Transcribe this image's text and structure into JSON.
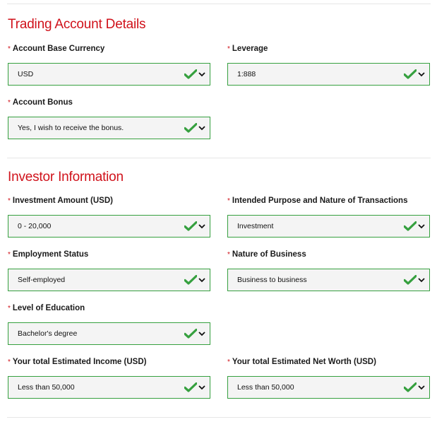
{
  "sections": [
    {
      "title": "Trading Account Details",
      "fields": [
        {
          "label": "Account Base Currency",
          "value": "USD",
          "required_mark": "*"
        },
        {
          "label": "Leverage",
          "value": "1:888",
          "required_mark": "*"
        },
        {
          "label": "Account Bonus",
          "value": "Yes, I wish to receive the bonus.",
          "required_mark": "*"
        }
      ]
    },
    {
      "title": "Investor Information",
      "fields": [
        {
          "label": "Investment Amount (USD)",
          "value": "0 - 20,000",
          "required_mark": "*"
        },
        {
          "label": "Intended Purpose and Nature of Transactions",
          "value": "Investment",
          "required_mark": "*"
        },
        {
          "label": "Employment Status",
          "value": "Self-employed",
          "required_mark": "*"
        },
        {
          "label": "Nature of Business",
          "value": "Business to business",
          "required_mark": "*"
        },
        {
          "label": "Level of Education",
          "value": "Bachelor's degree",
          "required_mark": "*"
        },
        {
          "label": "Your total Estimated Income (USD)",
          "value": "Less than 50,000",
          "required_mark": "*"
        },
        {
          "label": "Your total Estimated Net Worth (USD)",
          "value": "Less than 50,000",
          "required_mark": "*"
        }
      ]
    }
  ],
  "icons": {
    "valid": "checkmark-icon",
    "dropdown": "chevron-down-icon"
  },
  "colors": {
    "accent_red": "#d0121b",
    "valid_green": "#36a03f",
    "field_bg": "#f4f4f4"
  }
}
